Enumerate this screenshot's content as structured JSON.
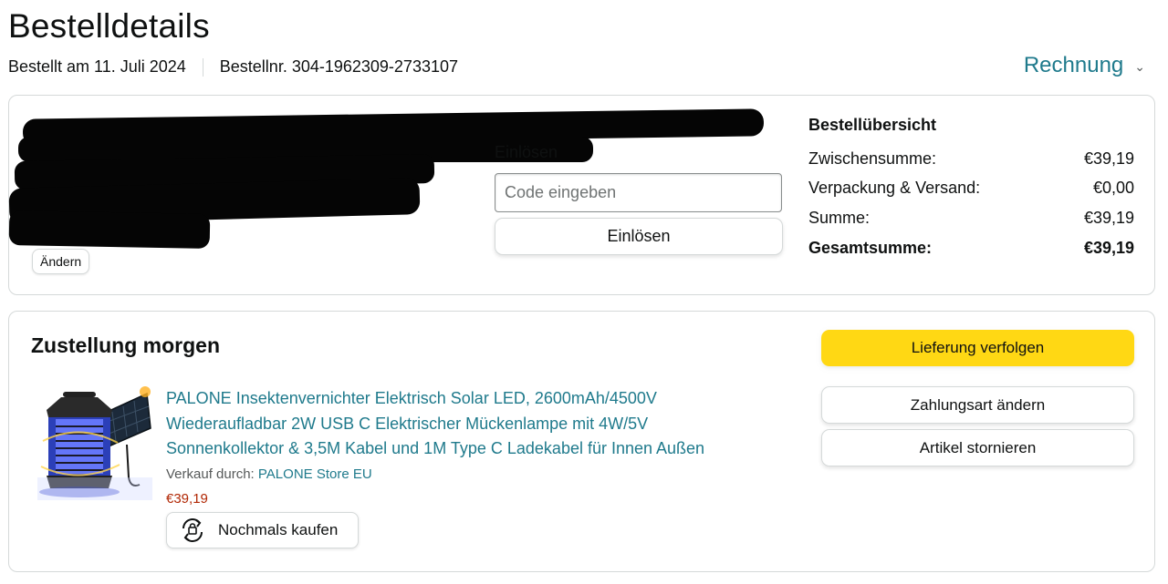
{
  "header": {
    "title": "Bestelldetails",
    "ordered_on": "Bestellt am 11. Juli 2024",
    "order_number": "Bestellnr. 304-1962309-2733107",
    "invoice_label": "Rechnung"
  },
  "address_card": {
    "edit_label": "Ändern"
  },
  "coupon": {
    "label": "Einlösen",
    "placeholder": "Code eingeben",
    "redeem_label": "Einlösen"
  },
  "summary": {
    "title": "Bestellübersicht",
    "rows": [
      {
        "label": "Zwischensumme:",
        "value": "€39,19"
      },
      {
        "label": "Verpackung & Versand:",
        "value": "€0,00"
      },
      {
        "label": "Summe:",
        "value": "€39,19"
      },
      {
        "label": "Gesamtsumme:",
        "value": "€39,19"
      }
    ]
  },
  "shipment": {
    "title": "Zustellung morgen",
    "product": {
      "name": "PALONE Insektenvernichter Elektrisch Solar LED, 2600mAh/4500V Wiederaufladbar 2W USB C Elektrischer Mückenlampe mit 4W/5V Sonnenkollektor & 3,5M Kabel und 1M Type C Ladekabel für Innen Außen",
      "seller_prefix": "Verkauf durch: ",
      "seller": "PALONE Store EU",
      "price": "€39,19",
      "buy_again_label": "Nochmals kaufen"
    },
    "actions": {
      "track": "Lieferung verfolgen",
      "change_payment": "Zahlungsart ändern",
      "cancel": "Artikel stornieren"
    }
  },
  "colors": {
    "link": "#1f7a8c",
    "price": "#b12704",
    "primary_button": "#ffd814"
  }
}
